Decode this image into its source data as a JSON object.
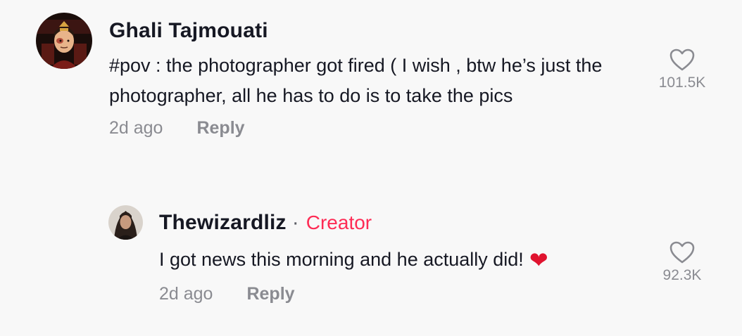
{
  "colors": {
    "background": "#f8f8f8",
    "text_primary": "#161823",
    "text_secondary": "#8a8b91",
    "creator_accent": "#fe2c55",
    "heart_emoji": "#e0132f"
  },
  "comments": [
    {
      "username": "Ghali Tajmouati",
      "text": "#pov : the photographer got fired ( I wish , btw he’s just the photographer, all he has to do is to take the pics",
      "time": "2d ago",
      "reply_label": "Reply",
      "likes": "101.5K",
      "avatar_icon": "avatar-cartoon-character",
      "like_icon": "heart-outline-icon"
    },
    {
      "username": "Thewizardliz",
      "separator": "·",
      "badge": "Creator",
      "text": "I got news this morning and he actually did!",
      "emoji": "❤️",
      "time": "2d ago",
      "reply_label": "Reply",
      "likes": "92.3K",
      "avatar_icon": "avatar-photo-woman",
      "like_icon": "heart-outline-icon"
    }
  ]
}
